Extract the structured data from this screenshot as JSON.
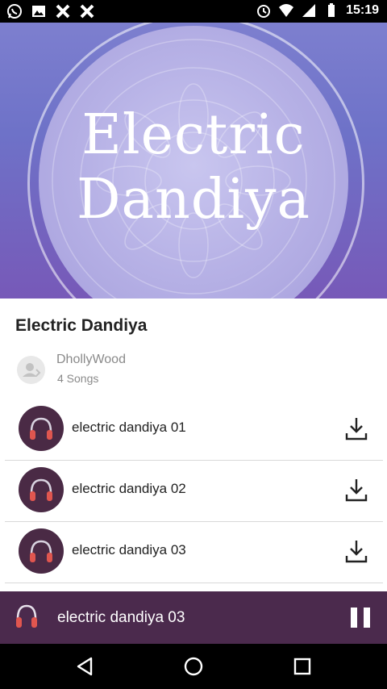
{
  "status_bar": {
    "time": "15:19",
    "left_icons": [
      "whatsapp-icon",
      "image-icon",
      "x-app-icon",
      "x-app-icon"
    ],
    "right_icons": [
      "alarm-icon",
      "wifi-icon",
      "signal-icon",
      "battery-icon"
    ]
  },
  "hero": {
    "title_line1": "Electric",
    "title_line2": "Dandiya",
    "colors": {
      "top": "#7d7fcf",
      "bottom": "#7759b8"
    }
  },
  "album": {
    "title": "Electric Dandiya",
    "artist": "DhollyWood",
    "song_count": "4 Songs"
  },
  "songs": [
    {
      "title": "electric dandiya 01",
      "icon": "headphones-icon",
      "action_icon": "download-icon"
    },
    {
      "title": "electric dandiya 02",
      "icon": "headphones-icon",
      "action_icon": "download-icon"
    },
    {
      "title": "electric dandiya 03",
      "icon": "headphones-icon",
      "action_icon": "download-icon"
    }
  ],
  "player": {
    "now_playing": "electric dandiya 03",
    "state_icon": "pause-icon",
    "background": "#4b2a4d"
  },
  "nav_bar": {
    "buttons": [
      "back-icon",
      "home-icon",
      "recents-icon"
    ]
  }
}
